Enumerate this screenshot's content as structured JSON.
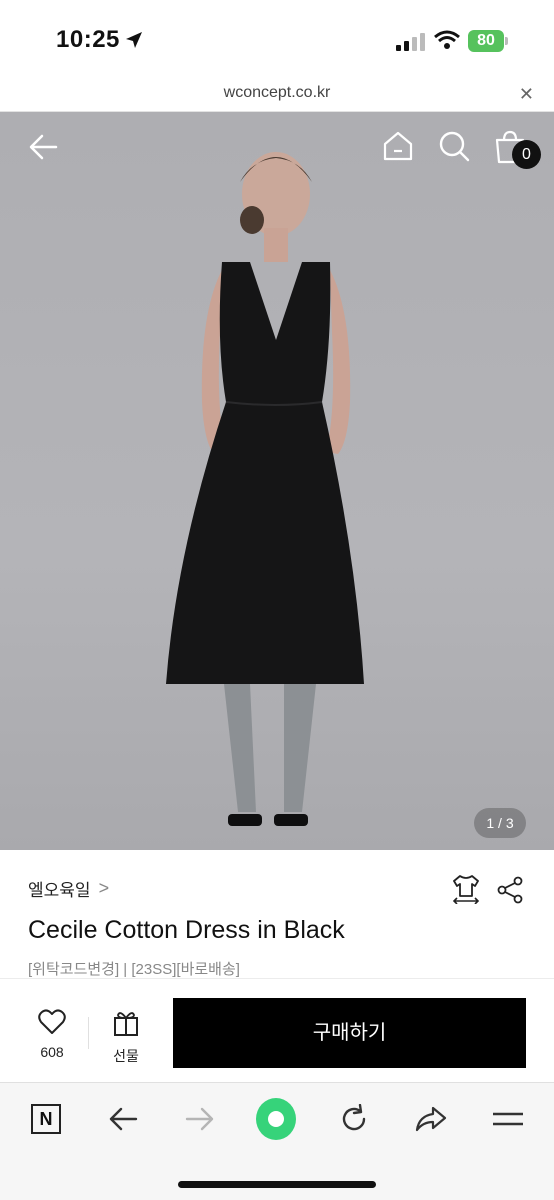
{
  "status_bar": {
    "time": "10:25",
    "battery": "80",
    "battery_color": "#56c25d"
  },
  "browser": {
    "url": "wconcept.co.kr",
    "close_glyph": "✕"
  },
  "header": {
    "back_icon": "arrow-left-icon",
    "home_icon": "home-icon",
    "search_icon": "search-icon",
    "cart_icon": "shopping-bag-icon",
    "cart_count": "0"
  },
  "gallery": {
    "pager": "1 / 3"
  },
  "product": {
    "brand": "엘오육일",
    "brand_chevron": ">",
    "name": "Cecile Cotton Dress in Black",
    "tags": "[위탁코드변경] | [23SS][바로배송]",
    "size_icon": "size-guide-icon",
    "share_icon": "share-icon"
  },
  "actions": {
    "like_count": "608",
    "gift_label": "선물",
    "buy_label": "구매하기"
  },
  "toolbar": {
    "n_label": "N"
  },
  "colors": {
    "buy_button": "#000000",
    "toolbar_accent": "#36d37a"
  }
}
